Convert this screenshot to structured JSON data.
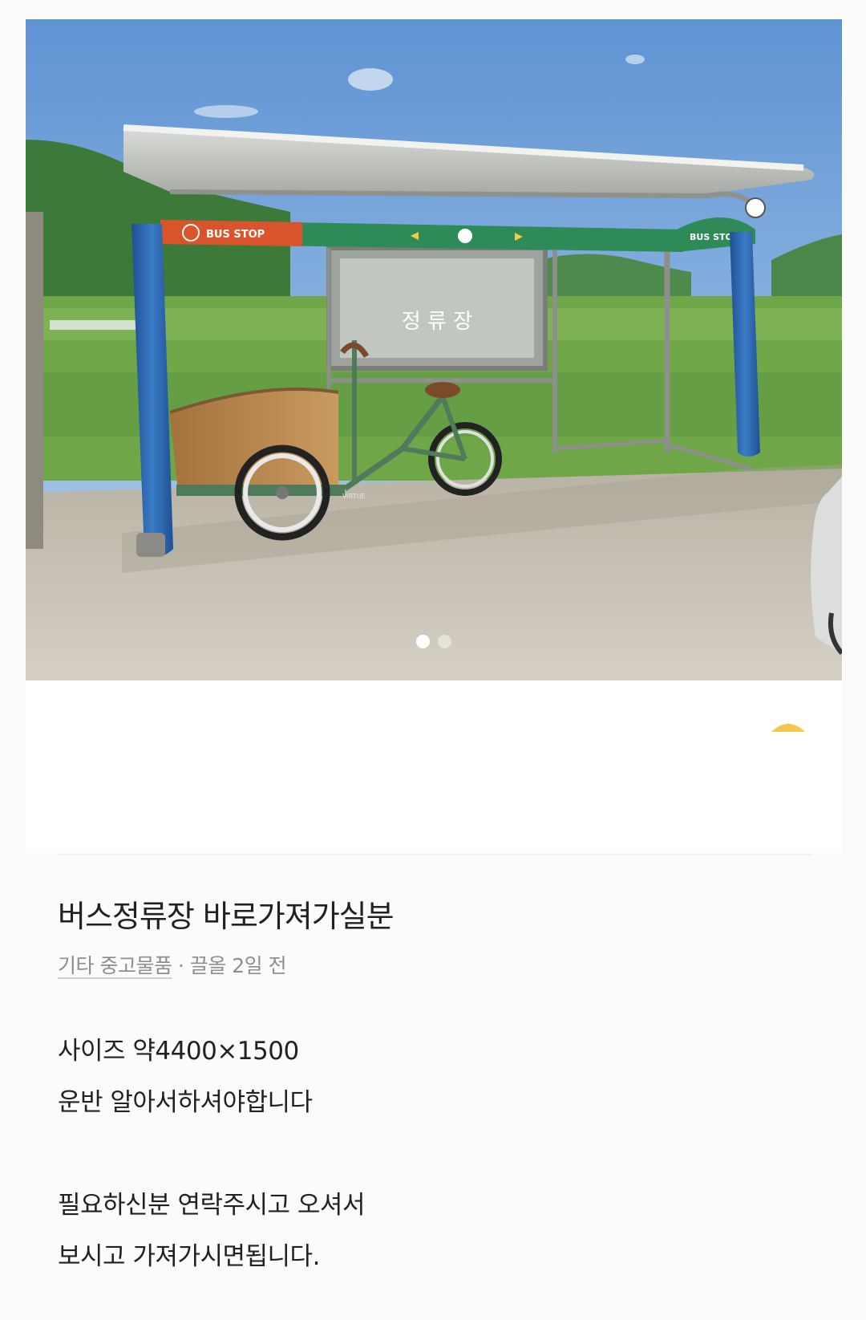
{
  "listing": {
    "title": "버스정류장 바로가져가실분",
    "category": "기타 중고물품",
    "separator": " · ",
    "time_ago": "끌올 2일 전",
    "description": [
      "사이즈 약4400×1500",
      "운반 알아서하셔야합니다",
      "",
      "필요하신분 연락주시고 오셔서",
      "보시고 가져가시면됩니다."
    ]
  },
  "photo": {
    "signs": {
      "bus_stop_left": "BUS STOP",
      "bus_stop_right": "BUS STOP",
      "stop_name": "정 류 장",
      "bike_brand": "VIRTUE"
    },
    "carousel": {
      "total": 2,
      "active_index": 0
    }
  },
  "colors": {
    "sky": "#6fa0d8",
    "post_blue": "#2f6db5",
    "sign_orange": "#d9542b",
    "sign_green": "#2e8b57",
    "manner_icon": "#f2c94c"
  }
}
